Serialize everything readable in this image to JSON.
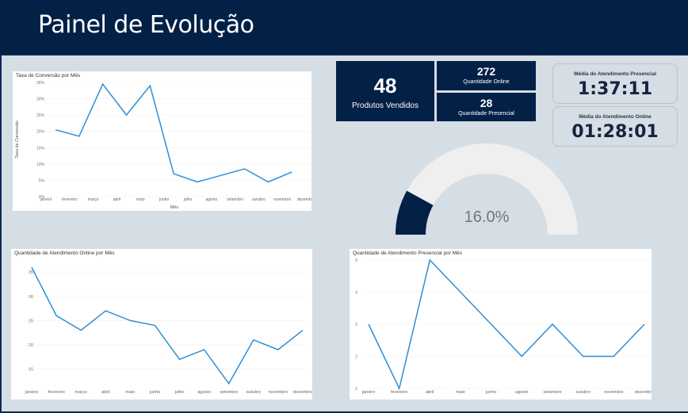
{
  "header": {
    "title": "Painel de Evolução"
  },
  "kpis": {
    "produtos_vendidos": {
      "value": "48",
      "label": "Produtos Vendidos"
    },
    "quantidade_online": {
      "value": "272",
      "label": "Quantidade Online"
    },
    "quantidade_presencial": {
      "value": "28",
      "label": "Quantidade Presencial"
    },
    "media_presencial": {
      "label": "Média do Atendimento Presencial",
      "value": "1:37:11"
    },
    "media_online": {
      "label": "Média do Atendimento Online",
      "value": "01:28:01"
    }
  },
  "gauge": {
    "label": "16.0%",
    "value_fraction": 0.16,
    "fill_color": "#032046",
    "track_color": "#f0efef"
  },
  "colors": {
    "line": "#2d8fd5",
    "header": "#032046",
    "background": "#d5dde5"
  },
  "chart_data": [
    {
      "type": "line",
      "title": "Taxa de Conversão por Mês",
      "xlabel": "Mês",
      "ylabel": "Taxa de Conversão",
      "categories": [
        "janeiro",
        "fevereiro",
        "março",
        "abril",
        "maio",
        "junho",
        "julho",
        "agosto",
        "setembro",
        "outubro",
        "novembro",
        "dezembro"
      ],
      "values": [
        20.5,
        18.5,
        34.5,
        25,
        34,
        7,
        4.5,
        6.5,
        8.5,
        4.5,
        7.5,
        null
      ],
      "y_ticks": [
        "0%",
        "5%",
        "10%",
        "15%",
        "20%",
        "25%",
        "30%",
        "35%"
      ],
      "ylim": [
        0,
        35
      ]
    },
    {
      "type": "line",
      "title": "Quantidade de Atendimento Online por Mês",
      "categories": [
        "janeiro",
        "fevereiro",
        "março",
        "abril",
        "maio",
        "junho",
        "julho",
        "agosto",
        "setembro",
        "outubro",
        "novembro",
        "dezembro"
      ],
      "values": [
        36,
        26,
        23,
        27,
        25,
        24,
        17,
        19,
        12,
        21,
        19,
        23
      ],
      "y_ticks": [
        "15",
        "20",
        "25",
        "30",
        "35"
      ],
      "ylim": [
        11,
        36.5
      ]
    },
    {
      "type": "line",
      "title": "Quantidade de Atendimento Presencial por Mês",
      "categories": [
        "janeiro",
        "fevereiro",
        "abril",
        "maio",
        "junho",
        "agosto",
        "setembro",
        "outubro",
        "novembro",
        "dezembro"
      ],
      "values": [
        3,
        1,
        5,
        4,
        3,
        2,
        3,
        2,
        2,
        3
      ],
      "y_ticks": [
        "1",
        "2",
        "3",
        "4",
        "5"
      ],
      "ylim": [
        1,
        5
      ]
    }
  ]
}
